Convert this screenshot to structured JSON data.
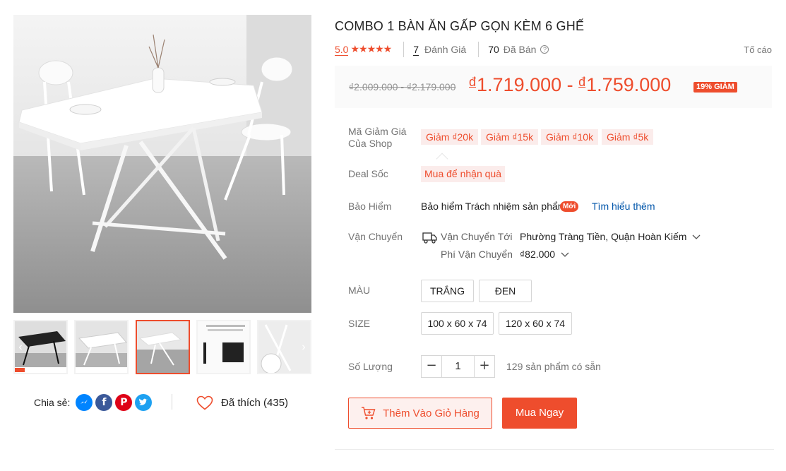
{
  "product": {
    "title": "COMBO 1 BÀN ĂN GẤP GỌN KÈM 6 GHẾ",
    "rating": "5.0",
    "stars": "★★★★★",
    "rating_value": 5,
    "reviews_count": "7",
    "reviews_label": "Đánh Giá",
    "sold_count": "70",
    "sold_label": "Đã Bán",
    "report_label": "Tố cáo"
  },
  "price": {
    "original": "₫2.009.000 - ₫2.179.000",
    "currency": "đ",
    "low": "1.719.000",
    "separator": " - ",
    "high": "1.759.000",
    "discount_badge": "19% GIẢM",
    "accent_color": "#ee4d2d"
  },
  "vouchers": {
    "label_line1": "Mã Giảm Giá",
    "label_line2": "Của Shop",
    "items": [
      "Giảm ₫20k",
      "Giảm ₫15k",
      "Giảm ₫10k",
      "Giảm ₫5k"
    ]
  },
  "deal": {
    "label": "Deal Sốc",
    "value": "Mua để nhận quà"
  },
  "insurance": {
    "label": "Bảo Hiểm",
    "value": "Bảo hiểm Trách nhiệm sản phẩm",
    "badge": "Mới",
    "link": "Tìm hiểu thêm"
  },
  "shipping": {
    "label": "Vận Chuyển",
    "to_label": "Vận Chuyển Tới",
    "to_value": "Phường Tràng Tiền, Quận Hoàn Kiếm",
    "fee_label": "Phí Vận Chuyển",
    "fee_value": "₫82.000"
  },
  "color": {
    "label": "MÀU",
    "options": [
      "TRẮNG",
      "ĐEN"
    ]
  },
  "size": {
    "label": "SIZE",
    "options": [
      "100 x 60 x 74",
      "120 x 60 x 74"
    ]
  },
  "quantity": {
    "label": "Số Lượng",
    "value": "1",
    "minus": "−",
    "plus": "+",
    "stock": "129 sản phẩm có sẵn"
  },
  "actions": {
    "add_to_cart": "Thêm Vào Giỏ Hàng",
    "buy_now": "Mua Ngay"
  },
  "social": {
    "share_label": "Chia sẻ:",
    "liked_label": "Đã thích (435)"
  },
  "gallery": {
    "thumbnail_count": 5,
    "active_index": 2
  }
}
